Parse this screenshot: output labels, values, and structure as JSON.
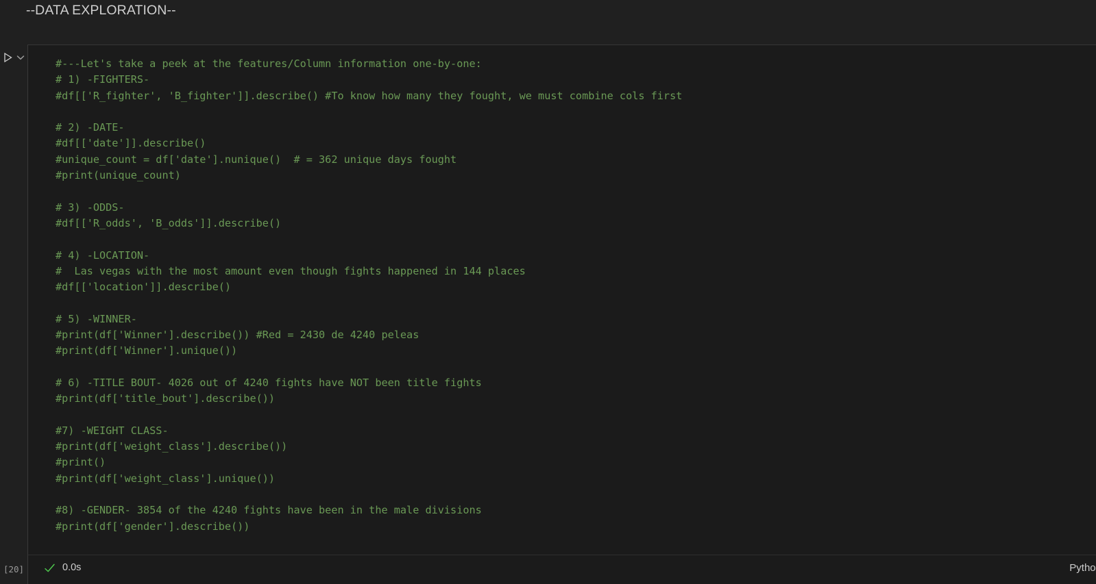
{
  "markdown_cell": {
    "heading": "--DATA EXPLORATION--"
  },
  "cell_controls": {
    "run_icon": "play-triangle-icon",
    "more_icon": "chevron-down-icon"
  },
  "code_cell": {
    "language": "Python",
    "execution_count_label": "[20]",
    "status": {
      "state_icon": "check-icon",
      "elapsed": "0.0s"
    },
    "lines": [
      "#---Let's take a peek at the features/Column information one-by-one:",
      "# 1) -FIGHTERS-",
      "#df[['R_fighter', 'B_fighter']].describe() #To know how many they fought, we must combine cols first",
      "",
      "# 2) -DATE-",
      "#df[['date']].describe()",
      "#unique_count = df['date'].nunique()  # = 362 unique days fought",
      "#print(unique_count)",
      "",
      "# 3) -ODDS-",
      "#df[['R_odds', 'B_odds']].describe()",
      "",
      "# 4) -LOCATION-",
      "#  Las vegas with the most amount even though fights happened in 144 places",
      "#df[['location']].describe()",
      "",
      "# 5) -WINNER-",
      "#print(df['Winner'].describe()) #Red = 2430 de 4240 peleas",
      "#print(df['Winner'].unique())",
      "",
      "# 6) -TITLE BOUT- 4026 out of 4240 fights have NOT been title fights",
      "#print(df['title_bout'].describe())",
      "",
      "#7) -WEIGHT CLASS-",
      "#print(df['weight_class'].describe())",
      "#print()",
      "#print(df['weight_class'].unique())",
      "",
      "#8) -GENDER- 3854 of the 4240 fights have been in the male divisions",
      "#print(df['gender'].describe())"
    ]
  },
  "colors": {
    "page_background": "#202020",
    "cell_background": "#1b1b1b",
    "comment_green": "#6a9955",
    "heading_gray": "#cfcfcf",
    "status_green": "#4ec94e"
  }
}
